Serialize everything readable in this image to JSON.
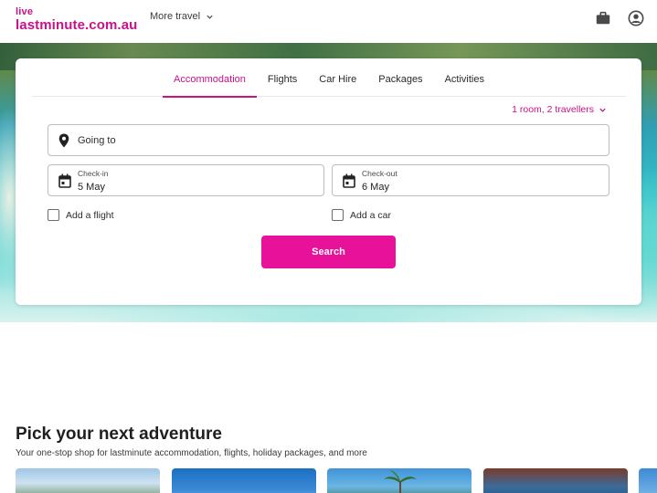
{
  "header": {
    "logo_top": "live",
    "logo_main": "lastminute.com.au",
    "more_travel": "More travel"
  },
  "search": {
    "tabs": [
      {
        "label": "Accommodation",
        "active": true
      },
      {
        "label": "Flights",
        "active": false
      },
      {
        "label": "Car Hire",
        "active": false
      },
      {
        "label": "Packages",
        "active": false
      },
      {
        "label": "Activities",
        "active": false
      }
    ],
    "travellers": "1 room, 2 travellers",
    "going_to": "Going to",
    "checkin_label": "Check-in",
    "checkin_value": "5 May",
    "checkout_label": "Check-out",
    "checkout_value": "6 May",
    "add_flight": "Add a flight",
    "add_car": "Add a car",
    "search_button": "Search"
  },
  "adventure": {
    "title": "Pick your next adventure",
    "subtitle": "Your one-stop shop for lastminute accommodation, flights, holiday packages, and more"
  },
  "colors": {
    "brand": "#c8128a",
    "button": "#e8119a"
  }
}
